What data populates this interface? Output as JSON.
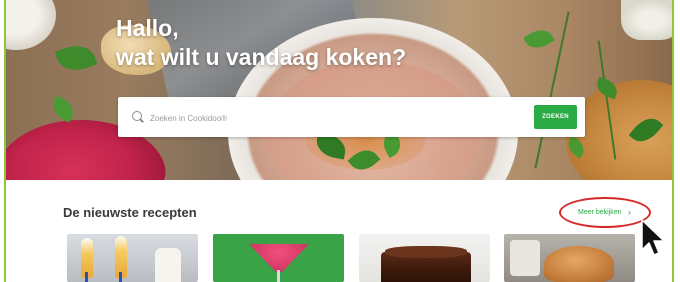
{
  "hero": {
    "greeting_line1": "Hallo,",
    "greeting_line2": "wat wilt u vandaag koken?"
  },
  "search": {
    "placeholder": "Zoeken in Cookidoo®",
    "button_label": "ZOEKEN",
    "icon": "search-icon"
  },
  "recipes_section": {
    "title": "De nieuwste recepten",
    "more_link": "Meer bekijken",
    "more_icon": "chevron-right-icon",
    "cards": [
      {
        "image": "champagne-glasses"
      },
      {
        "image": "pink-cocktail"
      },
      {
        "image": "chocolate-cake"
      },
      {
        "image": "roast-chicken"
      }
    ]
  },
  "annotations": {
    "highlight_color": "#d62a2a",
    "cursor_icon": "mouse-pointer-icon"
  },
  "colors": {
    "accent": "#2bab46",
    "frame": "#8dc63f"
  }
}
